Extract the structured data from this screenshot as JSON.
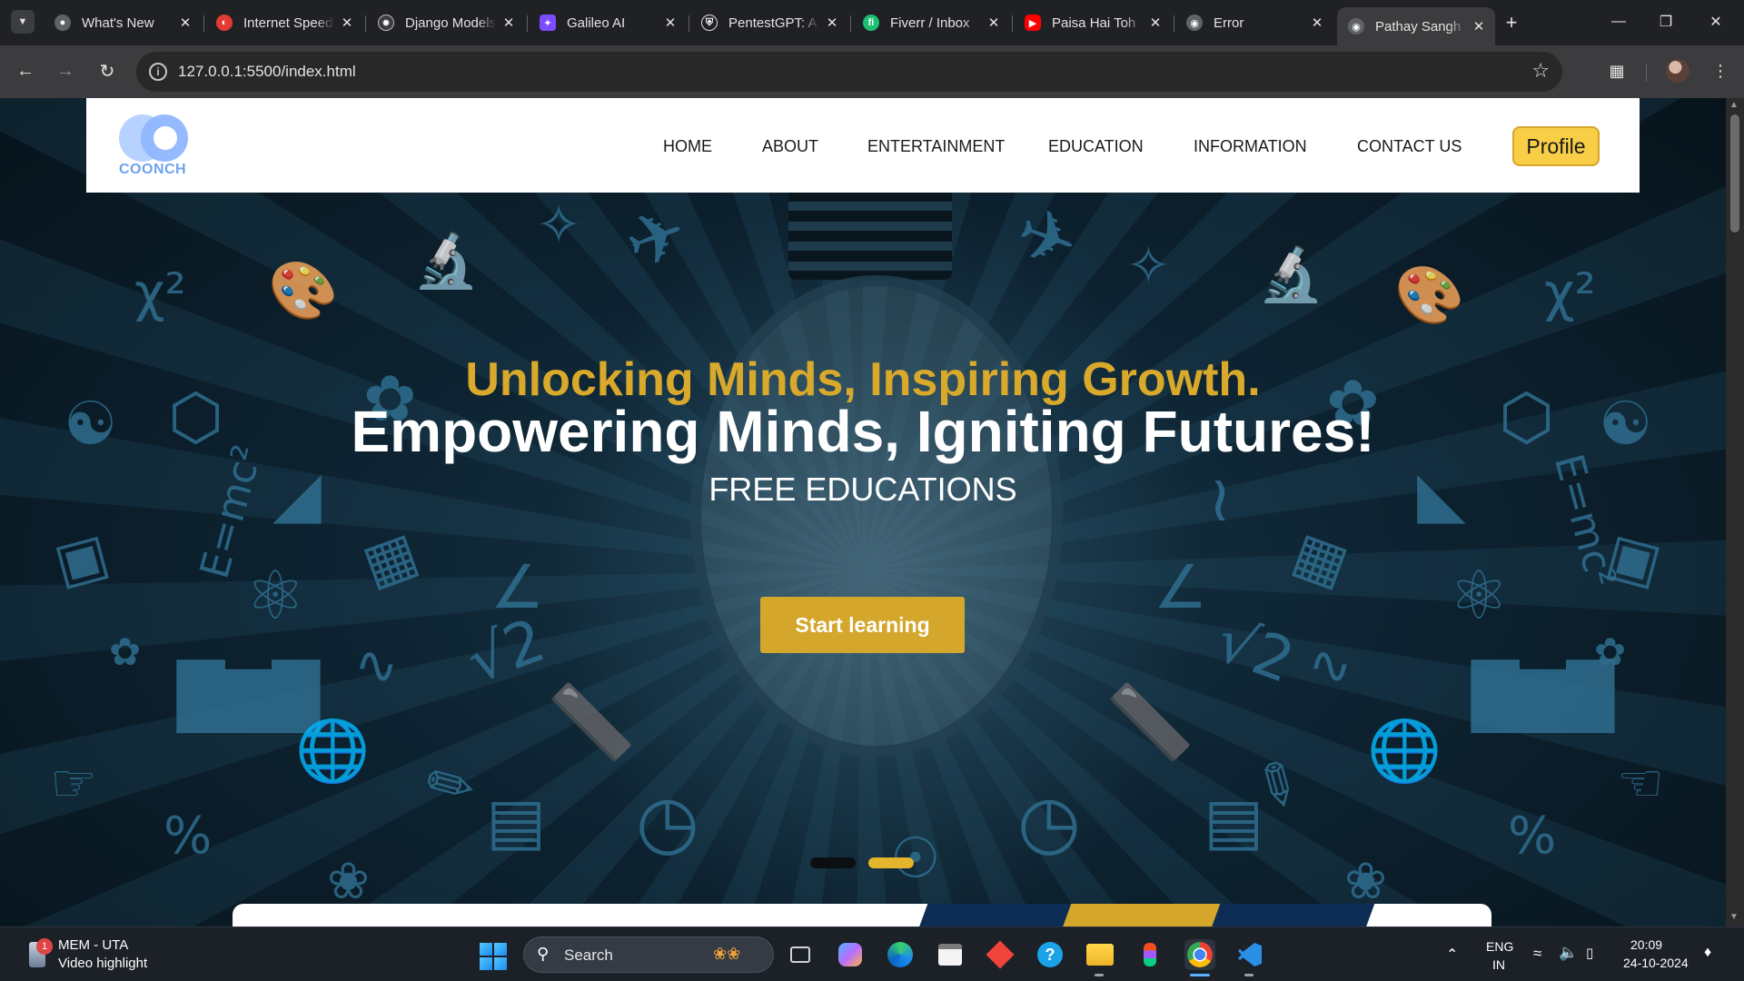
{
  "browser": {
    "tabs": [
      {
        "title": "What's New",
        "favicon": "chrome-icon",
        "color": "#5f6368"
      },
      {
        "title": "Internet Speed",
        "favicon": "speedtest-icon",
        "color": "#e53935"
      },
      {
        "title": "Django Models",
        "favicon": "openai-icon",
        "color": "#202124"
      },
      {
        "title": "Galileo AI",
        "favicon": "galileo-icon",
        "color": "#7c4dff"
      },
      {
        "title": "PentestGPT: A",
        "favicon": "shield-icon",
        "color": "#202124"
      },
      {
        "title": "Fiverr / Inbox",
        "favicon": "fiverr-icon",
        "color": "#1dbf73"
      },
      {
        "title": "Paisa Hai Toh",
        "favicon": "youtube-icon",
        "color": "#ff0000"
      },
      {
        "title": "Error",
        "favicon": "globe-icon",
        "color": "#5f6368"
      },
      {
        "title": "Pathay Sangh",
        "favicon": "globe-icon",
        "color": "#5f6368",
        "active": true
      }
    ],
    "url": "127.0.0.1:5500/index.html"
  },
  "site": {
    "logo_text": "COONCH",
    "nav": [
      "HOME",
      "ABOUT",
      "ENTERTAINMENT",
      "EDUCATION",
      "INFORMATION",
      "CONTACT US"
    ],
    "profile_label": "Profile",
    "hero": {
      "tagline": "Unlocking Minds, Inspiring Growth.",
      "headline": "Empowering Minds, Igniting Futures!",
      "subheading": "FREE EDUCATIONS",
      "cta_label": "Start learning",
      "slide_count": 2,
      "active_slide": 2
    },
    "colors": {
      "accent": "#d4a72c",
      "navy": "#0e2d55",
      "profile": "#f7ce46"
    }
  },
  "taskbar": {
    "widget_title": "MEM - UTA",
    "widget_subtitle": "Video highlight",
    "widget_badge": "1",
    "search_label": "Search",
    "apps": [
      "task-view-icon",
      "copilot-icon",
      "edge-icon",
      "store-icon",
      "anydesk-icon",
      "skype-icon",
      "file-explorer-icon",
      "figma-icon",
      "chrome-icon",
      "vscode-icon"
    ],
    "lang1": "ENG",
    "lang2": "IN",
    "time": "20:09",
    "date": "24-10-2024"
  }
}
